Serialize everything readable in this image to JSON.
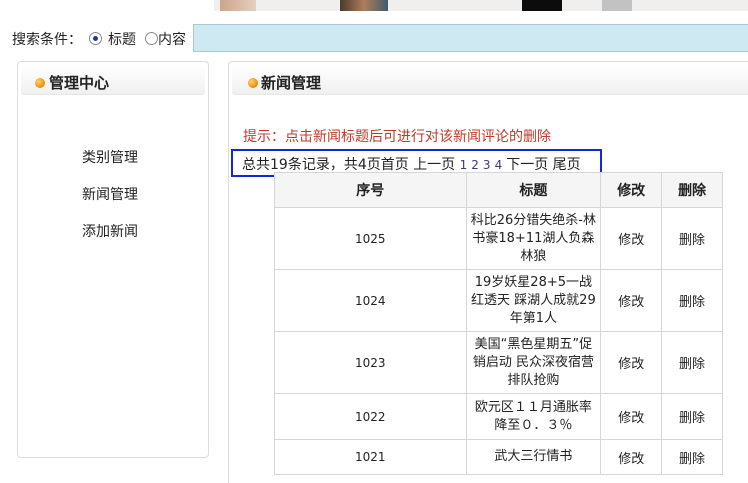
{
  "search": {
    "label": "搜索条件：",
    "options": [
      {
        "label": "标题",
        "checked": true
      },
      {
        "label": "内容",
        "checked": false
      }
    ],
    "value": ""
  },
  "sidebar": {
    "title": "管理中心",
    "items": [
      {
        "label": "类别管理"
      },
      {
        "label": "新闻管理"
      },
      {
        "label": "添加新闻"
      }
    ]
  },
  "main": {
    "title": "新闻管理",
    "hint": "提示：点击新闻标题后可进行对该新闻评论的删除",
    "pager": {
      "summary": "总共19条记录，共4页",
      "first": "首页",
      "prev": "上一页",
      "pages": [
        "1",
        "2",
        "3",
        "4"
      ],
      "next": "下一页",
      "last": "尾页"
    },
    "table": {
      "headers": [
        "序号",
        "标题",
        "修改",
        "删除"
      ],
      "rows": [
        {
          "id": "1025",
          "title": "科比26分错失绝杀-林书豪18+11湖人负森林狼",
          "edit": "修改",
          "delete": "删除"
        },
        {
          "id": "1024",
          "title": "19岁妖星28+5一战红透天 踩湖人成就29年第1人",
          "edit": "修改",
          "delete": "删除"
        },
        {
          "id": "1023",
          "title": "美国“黑色星期五”促销启动 民众深夜宿营排队抢购",
          "edit": "修改",
          "delete": "删除"
        },
        {
          "id": "1022",
          "title": "欧元区１１月通胀率降至０．３％",
          "edit": "修改",
          "delete": "删除"
        },
        {
          "id": "1021",
          "title": "武大三行情书",
          "edit": "修改",
          "delete": "删除"
        }
      ]
    }
  },
  "colors": {
    "hint": "#c0392b",
    "pager_highlight": "#1427d6",
    "search_input": "#cfe9f3",
    "accent_dot": "#f08a00"
  }
}
